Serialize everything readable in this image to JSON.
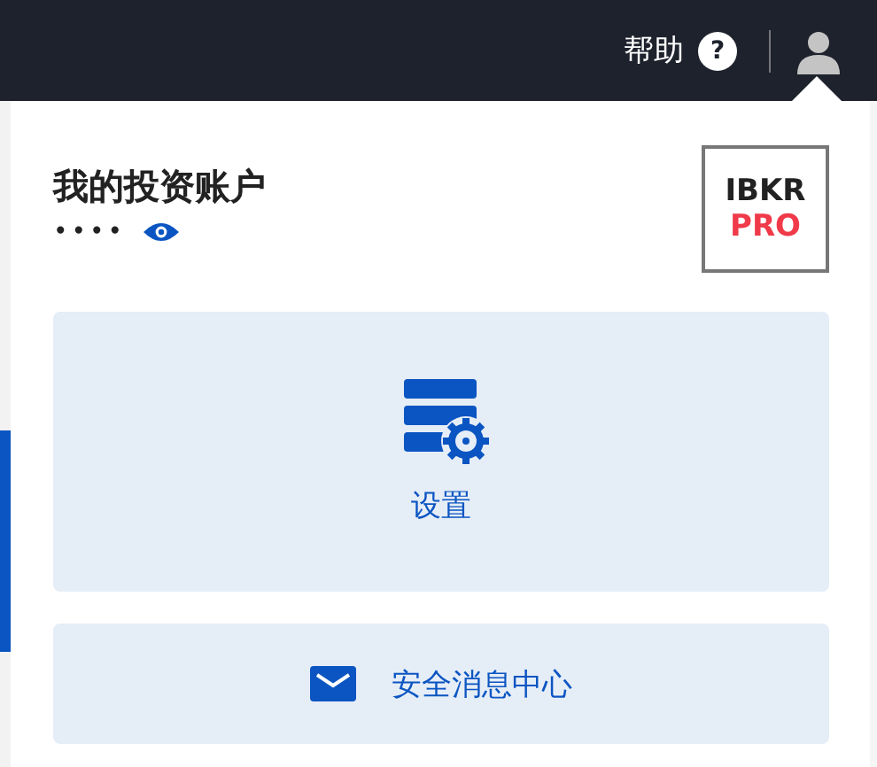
{
  "top_bar": {
    "help_label": "帮助",
    "help_icon": "?"
  },
  "account_panel": {
    "title": "我的投资账户",
    "masked_number": "••••",
    "logo": {
      "line_1": "IBKR",
      "line_2": "PRO"
    }
  },
  "menu_items": [
    {
      "label": "设置",
      "kind": "tile"
    },
    {
      "label": "安全消息中心",
      "kind": "row"
    }
  ]
}
